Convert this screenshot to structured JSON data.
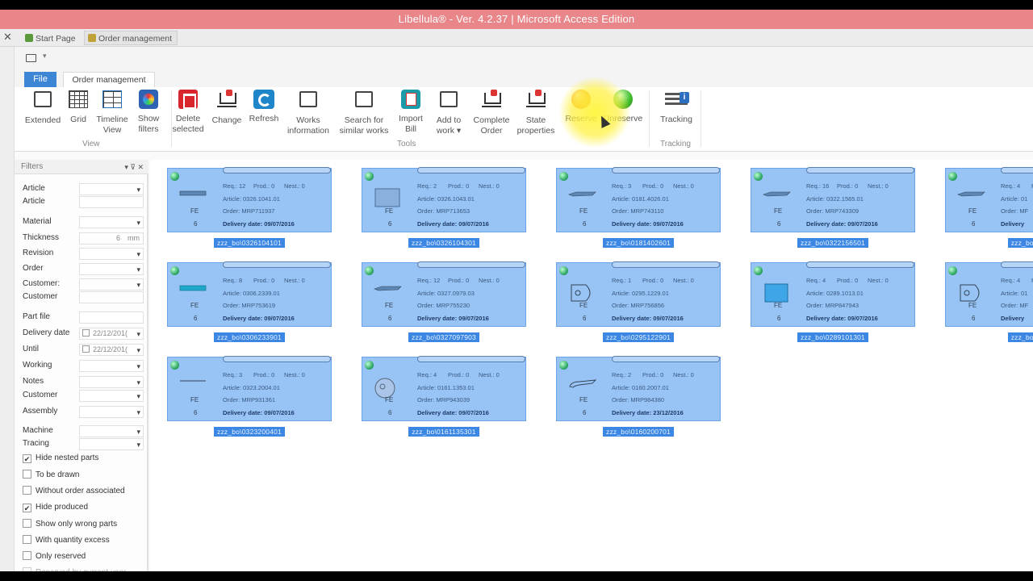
{
  "window": {
    "title": "Libellula® - Ver. 4.2.37 | Microsoft Access Edition"
  },
  "doc_tabs": [
    {
      "label": "Start Page",
      "icon": "home-icon"
    },
    {
      "label": "Order management",
      "icon": "order-icon"
    }
  ],
  "ribbon_tabs": {
    "file": "File",
    "order": "Order management"
  },
  "ribbon": {
    "buttons": [
      {
        "id": "extended",
        "l1": "Extended",
        "l2": "",
        "icon": "extended-icon"
      },
      {
        "id": "grid",
        "l1": "Grid",
        "l2": "",
        "icon": "grid-icon"
      },
      {
        "id": "timeline",
        "l1": "Timeline",
        "l2": "View",
        "icon": "timeline-icon"
      },
      {
        "id": "showfilters",
        "l1": "Show",
        "l2": "filters",
        "icon": "filter-icon"
      },
      {
        "id": "delete",
        "l1": "Delete",
        "l2": "selected",
        "icon": "trash-icon"
      },
      {
        "id": "change",
        "l1": "Change",
        "l2": "",
        "icon": "cart-icon"
      },
      {
        "id": "refresh",
        "l1": "Refresh",
        "l2": "",
        "icon": "refresh-icon"
      },
      {
        "id": "worksinfo",
        "l1": "Works",
        "l2": "information",
        "icon": "works-icon"
      },
      {
        "id": "search",
        "l1": "Search for",
        "l2": "similar works",
        "icon": "search-works-icon"
      },
      {
        "id": "import",
        "l1": "Import",
        "l2": "Bill",
        "icon": "import-icon"
      },
      {
        "id": "addwork",
        "l1": "Add to",
        "l2": "work ▾",
        "icon": "add-work-icon"
      },
      {
        "id": "complete",
        "l1": "Complete",
        "l2": "Order",
        "icon": "complete-order-icon"
      },
      {
        "id": "state",
        "l1": "State",
        "l2": "properties",
        "icon": "state-icon"
      },
      {
        "id": "reserve",
        "l1": "Reserve",
        "l2": "",
        "icon": "reserve-icon"
      },
      {
        "id": "unreserve",
        "l1": "Unreserve",
        "l2": "",
        "icon": "unreserve-icon"
      },
      {
        "id": "tracking",
        "l1": "Tracking",
        "l2": "",
        "icon": "tracking-icon"
      }
    ],
    "groups": {
      "view": "View",
      "tools": "Tools",
      "tracking": "Tracking"
    }
  },
  "filters": {
    "title": "Filters",
    "header_buttons": "▾ ⊽ ✕",
    "fields": [
      {
        "label": "Article",
        "value": ""
      },
      {
        "label": "Article",
        "value": ""
      },
      {
        "label": "Material",
        "value": ""
      },
      {
        "label": "Thickness",
        "value": "6",
        "unit": "mm"
      },
      {
        "label": "Revision",
        "value": ""
      },
      {
        "label": "Order",
        "value": ""
      },
      {
        "label": "Customer:",
        "value": ""
      },
      {
        "label": "Customer",
        "value": ""
      },
      {
        "label": "Part file",
        "value": ""
      },
      {
        "label": "Delivery date",
        "value": "22/12/201("
      },
      {
        "label": "Until",
        "value": "22/12/201("
      },
      {
        "label": "Working",
        "value": ""
      },
      {
        "label": "Notes",
        "value": ""
      },
      {
        "label": "Customer",
        "value": ""
      },
      {
        "label": "Assembly",
        "value": ""
      },
      {
        "label": "Machine",
        "value": ""
      },
      {
        "label": "Tracing",
        "value": ""
      }
    ],
    "checkboxes": [
      {
        "label": "Hide nested parts",
        "checked": true
      },
      {
        "label": "To be drawn",
        "checked": false
      },
      {
        "label": "Without order associated",
        "checked": false
      },
      {
        "label": "Hide produced",
        "checked": true
      },
      {
        "label": "Show only wrong parts",
        "checked": false
      },
      {
        "label": "With quantity excess",
        "checked": false
      },
      {
        "label": "Only reserved",
        "checked": false
      },
      {
        "label": "Reserved by current user",
        "checked": false
      }
    ]
  },
  "cards": [
    {
      "req": "Req.: 12",
      "prod": "Prod.: 0",
      "nest": "Nest.: 0",
      "article": "Article: 0326.1041.01",
      "order": "Order: MRP711937",
      "delivery": "Delivery date: 09/07/2016",
      "label": "zzz_bo\\0326104101",
      "material": "FE",
      "thick": "6",
      "shape": "bar"
    },
    {
      "req": "Req.: 2",
      "prod": "Prod.: 0",
      "nest": "Nest.: 0",
      "article": "Article: 0326.1043.01",
      "order": "Order: MRP713653",
      "delivery": "Delivery date: 09/07/2016",
      "label": "zzz_bo\\0326104301",
      "material": "FE",
      "thick": "6",
      "shape": "plate"
    },
    {
      "req": "Req.: 3",
      "prod": "Prod.: 0",
      "nest": "Nest.: 0",
      "article": "Article: 0181.4026.01",
      "order": "Order: MRP743110",
      "delivery": "Delivery date: 09/07/2016",
      "label": "zzz_bo\\0181402601",
      "material": "FE",
      "thick": "6",
      "shape": "blade"
    },
    {
      "req": "Req.: 16",
      "prod": "Prod.: 0",
      "nest": "Nest.: 0",
      "article": "Article: 0322.1565.01",
      "order": "Order: MRP743309",
      "delivery": "Delivery date: 09/07/2016",
      "label": "zzz_bo\\0322156501",
      "material": "FE",
      "thick": "6",
      "shape": "blade"
    },
    {
      "req": "Req.: 8",
      "prod": "Prod.: 0",
      "nest": "Nest.: 0",
      "article": "Article: 0306.2339.01",
      "order": "Order: MRP753619",
      "delivery": "Delivery date: 09/07/2016",
      "label": "zzz_bo\\0306233901",
      "material": "FE",
      "thick": "6",
      "shape": "bar-blue"
    },
    {
      "req": "Req.: 12",
      "prod": "Prod.: 0",
      "nest": "Nest.: 0",
      "article": "Article: 0327.0979.03",
      "order": "Order: MRP755230",
      "delivery": "Delivery date: 09/07/2016",
      "label": "zzz_bo\\0327097903",
      "material": "FE",
      "thick": "6",
      "shape": "blade"
    },
    {
      "req": "Req.: 1",
      "prod": "Prod.: 0",
      "nest": "Nest.: 0",
      "article": "Article: 0295.1229.01",
      "order": "Order: MRP756856",
      "delivery": "Delivery date: 09/07/2016",
      "label": "zzz_bo\\0295122901",
      "material": "FE",
      "thick": "6",
      "shape": "bracket"
    },
    {
      "req": "Req.: 4",
      "prod": "Prod.: 0",
      "nest": "Nest.: 0",
      "article": "Article: 0289.1013.01",
      "order": "Order: MRP847943",
      "delivery": "Delivery date: 09/07/2016",
      "label": "zzz_bo\\0289101301",
      "material": "FE",
      "thick": "6",
      "shape": "square-blue"
    },
    {
      "req": "Req.: 3",
      "prod": "Prod.: 0",
      "nest": "Nest.: 0",
      "article": "Article: 0323.2004.01",
      "order": "Order: MRP931361",
      "delivery": "Delivery date: 09/07/2016",
      "label": "zzz_bo\\0323200401",
      "material": "FE",
      "thick": "6",
      "shape": "line"
    },
    {
      "req": "Req.: 4",
      "prod": "Prod.: 0",
      "nest": "Nest.: 0",
      "article": "Article: 0161.1353.01",
      "order": "Order: MRP943039",
      "delivery": "Delivery date: 09/07/2016",
      "label": "zzz_bo\\0161135301",
      "material": "FE",
      "thick": "6",
      "shape": "circle"
    },
    {
      "req": "Req.: 2",
      "prod": "Prod.: 0",
      "nest": "Nest.: 0",
      "article": "Article: 0160.2007.01",
      "order": "Order: MRP984380",
      "delivery": "Delivery date: 23/12/2016",
      "label": "zzz_bo\\0160200701",
      "material": "FE",
      "thick": "6",
      "shape": "hook"
    },
    {
      "req": "Req.: 4",
      "prod": "Prod.: 0",
      "nest": "Nest.: 0",
      "article": "Article: 01",
      "order": "Order: MF",
      "delivery": "Delivery",
      "label": "zzz_bo\\01",
      "material": "FE",
      "thick": "6",
      "shape": "blade"
    },
    {
      "req": "Req.: 4",
      "prod": "Prod.: 0",
      "nest": "Nest.: 0",
      "article": "Article: 01",
      "order": "Order: MF",
      "delivery": "Delivery",
      "label": "zzz_bo\\01",
      "material": "FE",
      "thick": "6",
      "shape": "bracket"
    }
  ]
}
